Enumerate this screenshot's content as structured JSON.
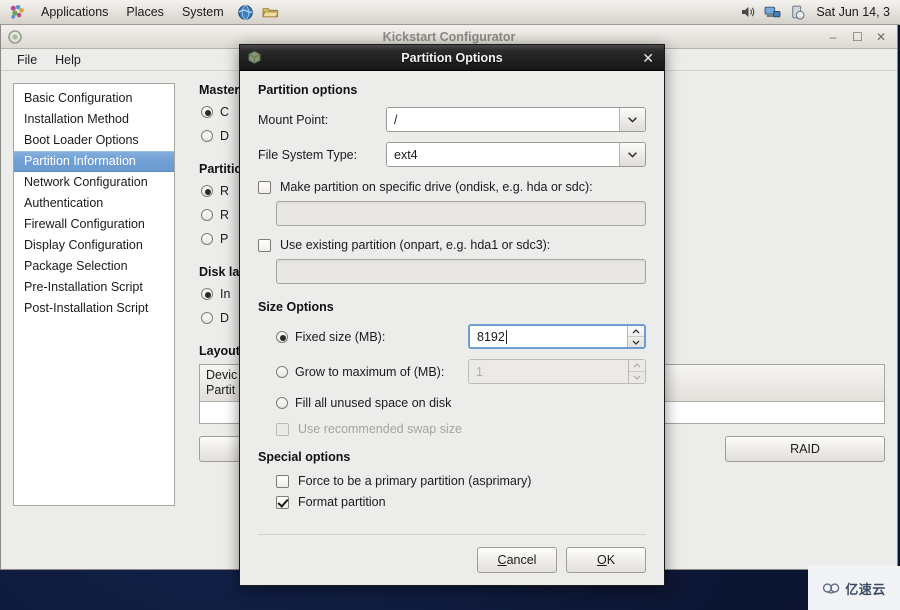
{
  "panel": {
    "menus": [
      "Applications",
      "Places",
      "System"
    ],
    "launcher_icons": [
      "globe-icon",
      "folder-icon"
    ],
    "tray_icons": [
      "volume-icon",
      "network-icon",
      "updates-icon"
    ],
    "clock": "Sat Jun 14, 3"
  },
  "main_window": {
    "title": "Kickstart Configurator",
    "window_buttons": {
      "minimize": "–",
      "maximize": "☐",
      "close": "✕"
    },
    "menubar": [
      "File",
      "Help"
    ],
    "sidebar": {
      "items": [
        {
          "label": "Basic Configuration",
          "selected": false
        },
        {
          "label": "Installation Method",
          "selected": false
        },
        {
          "label": "Boot Loader Options",
          "selected": false
        },
        {
          "label": "Partition Information",
          "selected": true
        },
        {
          "label": "Network Configuration",
          "selected": false
        },
        {
          "label": "Authentication",
          "selected": false
        },
        {
          "label": "Firewall Configuration",
          "selected": false
        },
        {
          "label": "Display Configuration",
          "selected": false
        },
        {
          "label": "Package Selection",
          "selected": false
        },
        {
          "label": "Pre-Installation Script",
          "selected": false
        },
        {
          "label": "Post-Installation Script",
          "selected": false
        }
      ]
    },
    "groups": [
      {
        "title": "Master",
        "options": [
          {
            "label": "C",
            "checked": true
          },
          {
            "label": "D",
            "checked": false
          }
        ]
      },
      {
        "title": "Partitio",
        "options": [
          {
            "label": "R",
            "checked": true
          },
          {
            "label": "R",
            "checked": false
          },
          {
            "label": "P",
            "checked": false
          }
        ]
      },
      {
        "title": "Disk la",
        "options": [
          {
            "label": "In",
            "checked": true
          },
          {
            "label": "D",
            "checked": false
          }
        ]
      }
    ],
    "layout_section": {
      "title": "Layout",
      "table_header_line1": "Devic",
      "table_header_line2": "Partit"
    },
    "buttons": {
      "raid": "RAID"
    }
  },
  "dialog": {
    "title": "Partition Options",
    "title_icon": "package-icon",
    "close_icon": "close-icon",
    "sections": {
      "partition_options": {
        "heading": "Partition options",
        "mount_point": {
          "label": "Mount Point:",
          "value": "/",
          "arrow_icon": "chevron-down-icon"
        },
        "file_system_type": {
          "label": "File System Type:",
          "value": "ext4",
          "arrow_icon": "chevron-down-icon"
        },
        "ondisk": {
          "label": "Make partition on specific drive (ondisk, e.g. hda or sdc):",
          "checked": false,
          "value": "",
          "placeholder": ""
        },
        "onpart": {
          "label": "Use existing partition (onpart, e.g. hda1 or sdc3):",
          "checked": false,
          "value": "",
          "placeholder": ""
        }
      },
      "size_options": {
        "heading": "Size Options",
        "fixed_size": {
          "label": "Fixed size (MB):",
          "selected": true,
          "value": "8192",
          "enabled": true
        },
        "grow_to_max": {
          "label": "Grow to maximum of (MB):",
          "selected": false,
          "value": "1",
          "enabled": false
        },
        "fill_unused": {
          "label": "Fill all unused space on disk",
          "selected": false
        },
        "recommended_swap": {
          "label": "Use recommended swap size",
          "checked": false,
          "enabled": false
        }
      },
      "special_options": {
        "heading": "Special options",
        "asprimary": {
          "label": "Force to be a primary partition (asprimary)",
          "checked": false
        },
        "format": {
          "label": "Format partition",
          "checked": true
        }
      }
    },
    "footer": {
      "cancel": {
        "prefix": "",
        "mnemonic": "C",
        "suffix": "ancel"
      },
      "ok": {
        "prefix": "",
        "mnemonic": "O",
        "suffix": "K"
      }
    }
  },
  "watermark": {
    "text": "亿速云",
    "icon": "cloud-icon"
  },
  "colors": {
    "selection_blue": "#6f9fd4",
    "focus_blue": "#6d9dd3",
    "desktop": "#0d1736",
    "dialog_titlebar": "#171717",
    "window_bg": "#ececea"
  }
}
